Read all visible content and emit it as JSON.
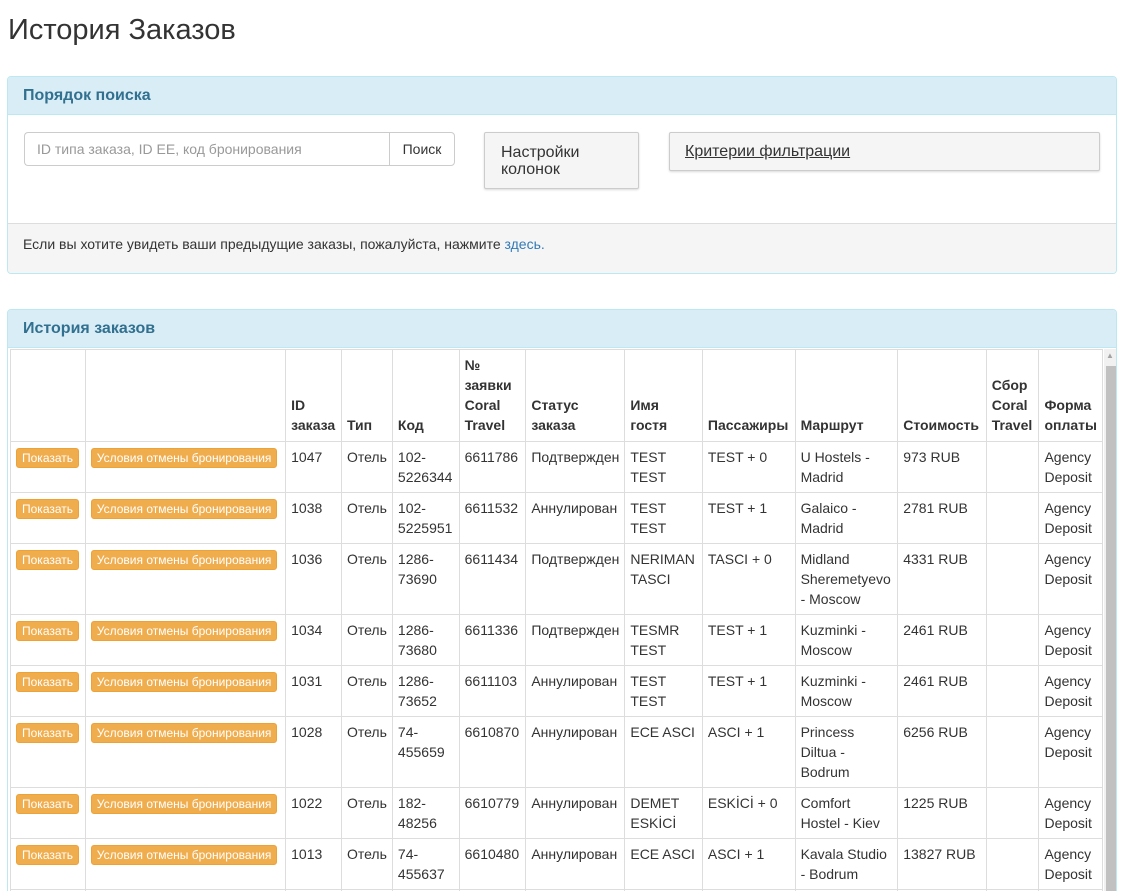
{
  "page": {
    "title": "История Заказов"
  },
  "search": {
    "heading": "Порядок поиска",
    "placeholder": "ID типа заказа, ID EE, код бронирования",
    "search_label": "Поиск",
    "col_settings_label": "Настройки колонок",
    "filter_label": "Критерии фильтрации",
    "footer_text": "Если вы хотите увидеть ваши предыдущие заказы, пожалуйста, нажмите ",
    "footer_link": "здесь."
  },
  "history": {
    "heading": "История заказов",
    "columns": [
      "",
      "",
      "ID заказа",
      "Тип",
      "Код",
      "№ заявки Coral Travel",
      "Статус заказа",
      "Имя гостя",
      "Пассажиры",
      "Маршрут",
      "Стоимость",
      "Сбор Coral Travel",
      "Форма оплаты"
    ],
    "show_label": "Показать",
    "cancel_label": "Условия отмены бронирования",
    "rows": [
      {
        "id": "1047",
        "type": "Отель",
        "code": "102-5226344",
        "coral": "6611786",
        "status": "Подтвержден",
        "guest": "TEST TEST",
        "pax": "TEST + 0",
        "route": "U Hostels - Madrid",
        "price": "973 RUB",
        "fee": "",
        "payment": "Agency Deposit"
      },
      {
        "id": "1038",
        "type": "Отель",
        "code": "102-5225951",
        "coral": "6611532",
        "status": "Аннулирован",
        "guest": "TEST TEST",
        "pax": "TEST + 1",
        "route": "Galaico - Madrid",
        "price": "2781 RUB",
        "fee": "",
        "payment": "Agency Deposit"
      },
      {
        "id": "1036",
        "type": "Отель",
        "code": "1286-73690",
        "coral": "6611434",
        "status": "Подтвержден",
        "guest": "NERIMAN TASCI",
        "pax": "TASCI + 0",
        "route": "Midland Sheremetyevo - Moscow",
        "price": "4331 RUB",
        "fee": "",
        "payment": "Agency Deposit"
      },
      {
        "id": "1034",
        "type": "Отель",
        "code": "1286-73680",
        "coral": "6611336",
        "status": "Подтвержден",
        "guest": "TESMR TEST",
        "pax": "TEST + 1",
        "route": "Kuzminki - Moscow",
        "price": "2461 RUB",
        "fee": "",
        "payment": "Agency Deposit"
      },
      {
        "id": "1031",
        "type": "Отель",
        "code": "1286-73652",
        "coral": "6611103",
        "status": "Аннулирован",
        "guest": "TEST TEST",
        "pax": "TEST + 1",
        "route": "Kuzminki - Moscow",
        "price": "2461 RUB",
        "fee": "",
        "payment": "Agency Deposit"
      },
      {
        "id": "1028",
        "type": "Отель",
        "code": "74-455659",
        "coral": "6610870",
        "status": "Аннулирован",
        "guest": "ECE ASCI",
        "pax": "ASCI + 1",
        "route": "Princess Diltua - Bodrum",
        "price": "6256 RUB",
        "fee": "",
        "payment": "Agency Deposit"
      },
      {
        "id": "1022",
        "type": "Отель",
        "code": "182-48256",
        "coral": "6610779",
        "status": "Аннулирован",
        "guest": "DEMET ESKİCİ",
        "pax": "ESKİCİ + 0",
        "route": "Comfort Hostel - Kiev",
        "price": "1225 RUB",
        "fee": "",
        "payment": "Agency Deposit"
      },
      {
        "id": "1013",
        "type": "Отель",
        "code": "74-455637",
        "coral": "6610480",
        "status": "Аннулирован",
        "guest": "ECE ASCI",
        "pax": "ASCI + 1",
        "route": "Kavala Studio - Bodrum",
        "price": "13827 RUB",
        "fee": "",
        "payment": "Agency Deposit"
      },
      {
        "id": "",
        "type": "",
        "code": "",
        "coral": "",
        "status": "",
        "guest": "",
        "pax": "",
        "route": "",
        "price": "",
        "fee": "",
        "payment": ""
      }
    ]
  }
}
